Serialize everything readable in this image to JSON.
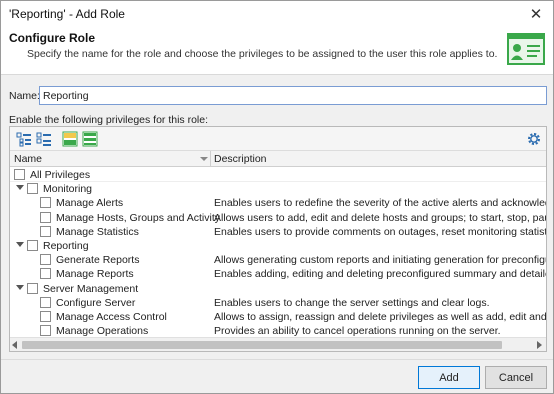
{
  "window": {
    "title": "'Reporting' - Add Role"
  },
  "header": {
    "title": "Configure Role",
    "description": "Specify the name for the role and choose the privileges to be assigned to the user this role applies to."
  },
  "form": {
    "name_label": "Name:",
    "name_value": "Reporting",
    "privileges_label": "Enable the following privileges for this role:"
  },
  "grid": {
    "columns": {
      "name": "Name",
      "description": "Description"
    },
    "rows": [
      {
        "level": 0,
        "expandable": false,
        "name": "All Privileges",
        "description": ""
      },
      {
        "level": 1,
        "expandable": true,
        "name": "Monitoring",
        "description": ""
      },
      {
        "level": 2,
        "expandable": false,
        "name": "Manage Alerts",
        "description": "Enables users to redefine the severity of the active alerts and acknowledge the"
      },
      {
        "level": 2,
        "expandable": false,
        "name": "Manage Hosts, Groups and Activity",
        "description": "Allows users to add, edit and delete hosts and groups; to start, stop, pause an"
      },
      {
        "level": 2,
        "expandable": false,
        "name": "Manage Statistics",
        "description": "Enables users to provide comments on outages, reset monitoring statistics for"
      },
      {
        "level": 1,
        "expandable": true,
        "name": "Reporting",
        "description": ""
      },
      {
        "level": 2,
        "expandable": false,
        "name": "Generate Reports",
        "description": "Allows generating custom reports and initiating generation for preconfigured"
      },
      {
        "level": 2,
        "expandable": false,
        "name": "Manage Reports",
        "description": "Enables adding, editing and deleting preconfigured summary and detailed rep"
      },
      {
        "level": 1,
        "expandable": true,
        "name": "Server Management",
        "description": ""
      },
      {
        "level": 2,
        "expandable": false,
        "name": "Configure Server",
        "description": "Enables users to change the server settings and clear logs."
      },
      {
        "level": 2,
        "expandable": false,
        "name": "Manage Access Control",
        "description": "Allows to assign, reassign and delete privileges as well as add, edit and delete"
      },
      {
        "level": 2,
        "expandable": false,
        "name": "Manage Operations",
        "description": "Provides an ability to cancel operations running on the server."
      }
    ]
  },
  "buttons": {
    "add": "Add",
    "cancel": "Cancel"
  },
  "icons": {
    "close": "close-icon",
    "expand_all": "expand-all-icon",
    "collapse_all": "collapse-all-icon",
    "select_all": "select-all-icon",
    "deselect_all": "deselect-all-icon",
    "settings": "gear-icon",
    "header": "role-card-icon"
  },
  "colors": {
    "accent": "#0078d7",
    "header_icon": "#3aa84a",
    "scroll_thumb": "#c2c2c2"
  }
}
